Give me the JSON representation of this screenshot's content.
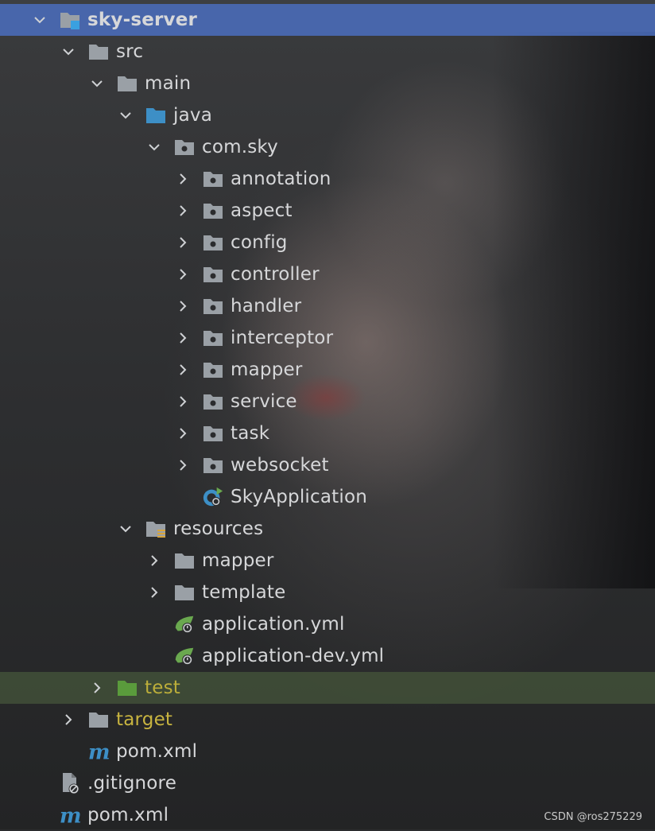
{
  "project_tree": {
    "rows": [
      {
        "label": "sky-server",
        "icon": "module-folder-icon",
        "expanded": true,
        "selected": true
      },
      {
        "label": "src",
        "icon": "folder-icon",
        "expanded": true
      },
      {
        "label": "main",
        "icon": "folder-icon",
        "expanded": true
      },
      {
        "label": "java",
        "icon": "source-root-folder-icon",
        "expanded": true
      },
      {
        "label": "com.sky",
        "icon": "package-icon",
        "expanded": true
      },
      {
        "label": "annotation",
        "icon": "package-icon",
        "expanded": false
      },
      {
        "label": "aspect",
        "icon": "package-icon",
        "expanded": false
      },
      {
        "label": "config",
        "icon": "package-icon",
        "expanded": false
      },
      {
        "label": "controller",
        "icon": "package-icon",
        "expanded": false
      },
      {
        "label": "handler",
        "icon": "package-icon",
        "expanded": false
      },
      {
        "label": "interceptor",
        "icon": "package-icon",
        "expanded": false
      },
      {
        "label": "mapper",
        "icon": "package-icon",
        "expanded": false
      },
      {
        "label": "service",
        "icon": "package-icon",
        "expanded": false
      },
      {
        "label": "task",
        "icon": "package-icon",
        "expanded": false
      },
      {
        "label": "websocket",
        "icon": "package-icon",
        "expanded": false
      },
      {
        "label": "SkyApplication",
        "icon": "spring-boot-app-icon"
      },
      {
        "label": "resources",
        "icon": "resources-folder-icon",
        "expanded": true
      },
      {
        "label": "mapper",
        "icon": "folder-icon",
        "expanded": false
      },
      {
        "label": "template",
        "icon": "folder-icon",
        "expanded": false
      },
      {
        "label": "application.yml",
        "icon": "spring-config-icon"
      },
      {
        "label": "application-dev.yml",
        "icon": "spring-config-icon"
      },
      {
        "label": "test",
        "icon": "test-folder-icon",
        "expanded": false
      },
      {
        "label": "target",
        "icon": "folder-icon",
        "expanded": false
      },
      {
        "label": "pom.xml",
        "icon": "maven-icon"
      },
      {
        "label": ".gitignore",
        "icon": "ignored-file-icon"
      },
      {
        "label": "pom.xml",
        "icon": "maven-icon"
      }
    ]
  },
  "watermark": "CSDN @ros275229",
  "colors": {
    "selection": "#4b6ebe",
    "folder": "#9aa0a6",
    "source_root": "#3d8fc6",
    "test_root": "#5a9b3c",
    "excluded_label": "#c8b440",
    "spring": "#6aa84f",
    "maven": "#3d8fc6"
  }
}
